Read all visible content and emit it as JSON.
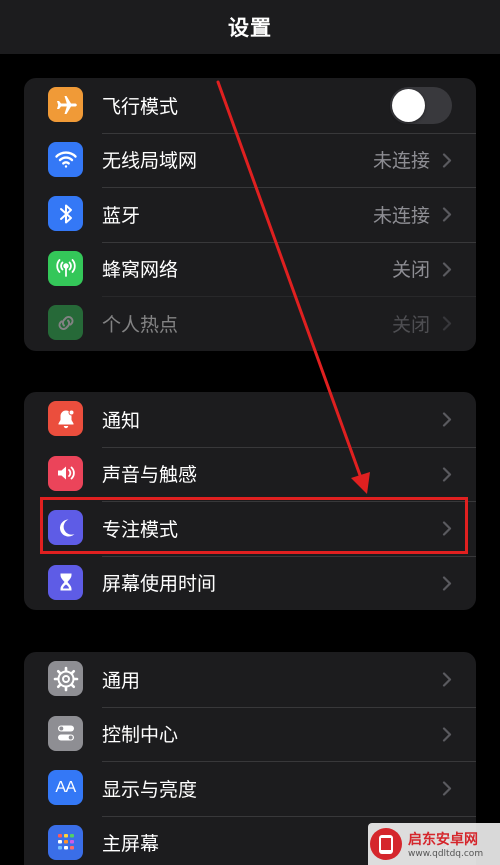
{
  "header": {
    "title": "设置"
  },
  "group1": {
    "airplane": {
      "label": "飞行模式",
      "toggle_on": false
    },
    "wifi": {
      "label": "无线局域网",
      "value": "未连接"
    },
    "bluetooth": {
      "label": "蓝牙",
      "value": "未连接"
    },
    "cellular": {
      "label": "蜂窝网络",
      "value": "关闭"
    },
    "hotspot": {
      "label": "个人热点",
      "value": "关闭"
    }
  },
  "group2": {
    "notifications": {
      "label": "通知"
    },
    "sounds": {
      "label": "声音与触感"
    },
    "focus": {
      "label": "专注模式"
    },
    "screen_time": {
      "label": "屏幕使用时间"
    }
  },
  "group3": {
    "general": {
      "label": "通用"
    },
    "control_center": {
      "label": "控制中心"
    },
    "display": {
      "label": "显示与亮度",
      "icon_text": "AA"
    },
    "home_screen": {
      "label": "主屏幕"
    }
  },
  "watermark": {
    "name": "启东安卓网",
    "url": "www.qdltdq.com"
  },
  "colors": {
    "airplane": "#f09a37",
    "wifi": "#3478f6",
    "bluetooth": "#3478f6",
    "cellular": "#34c759",
    "hotspot": "#34c759",
    "notifications": "#eb4e3d",
    "sounds": "#eb445a",
    "focus": "#5e5ce6",
    "screen_time": "#5e5ce6",
    "general": "#8e8e93",
    "control_center": "#8e8e93",
    "display": "#3478f6",
    "home_screen": "#3a6ee8",
    "annotation": "#e02020"
  }
}
